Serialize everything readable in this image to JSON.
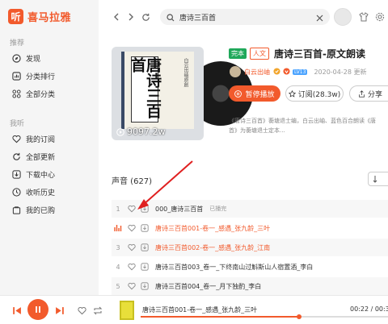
{
  "app": {
    "logo_mark": "听",
    "logo_text": "喜马拉雅"
  },
  "sidebar": {
    "section1": "推荐",
    "items1": [
      {
        "label": "发现",
        "icon": "compass-icon"
      },
      {
        "label": "分类排行",
        "icon": "ranking-icon"
      },
      {
        "label": "全部分类",
        "icon": "grid-icon"
      }
    ],
    "section2": "我听",
    "items2": [
      {
        "label": "我的订阅",
        "icon": "heart-icon"
      },
      {
        "label": "全部更新",
        "icon": "refresh-icon"
      },
      {
        "label": "下载中心",
        "icon": "download-icon"
      },
      {
        "label": "收听历史",
        "icon": "clock-icon"
      },
      {
        "label": "我的已购",
        "icon": "bag-icon"
      }
    ]
  },
  "search": {
    "query": "唐诗三百首"
  },
  "album": {
    "tag_finished": "完本",
    "tag_category": "人文",
    "title": "唐诗三百首-原文朗读",
    "cover_text": "唐诗三百首",
    "cover_side": "白云出岫原創",
    "play_count": "9097.2w",
    "author": "白云出岫",
    "level": "LV13",
    "date": "2020-04-28 更新",
    "play_button": "暂停播放",
    "subscribe_button": "订阅(28.3w)",
    "share_button": "分享",
    "desc_line1": "《唐诗三百首》蘅塘退士编，白云出岫、蓝色百合朗读《唐",
    "desc_line2": "首》为蘅塘退士定本..."
  },
  "tracks": {
    "header": "声音 (627)",
    "rows": [
      {
        "idx": "1",
        "title": "000_唐诗三百首",
        "played": "已播完"
      },
      {
        "idx": "",
        "title": "唐诗三百首001-卷一_感遇_张九龄_三叶",
        "played": ""
      },
      {
        "idx": "3",
        "title": "唐诗三百首002-卷一_感遇_张九龄_江南",
        "played": ""
      },
      {
        "idx": "4",
        "title": "唐诗三百首003_卷一_下终南山过斛斯山人宿置酒_李白",
        "played": ""
      },
      {
        "idx": "5",
        "title": "唐诗三百首004_卷一_月下独酌_李白",
        "played": ""
      }
    ]
  },
  "player": {
    "now_title": "唐诗三百首001-卷一_感遇_张九龄_三叶",
    "time": "00:22 / 00:34",
    "progress": 0.64
  },
  "colors": {
    "accent": "#f25a2c",
    "green": "#1fa85a"
  }
}
